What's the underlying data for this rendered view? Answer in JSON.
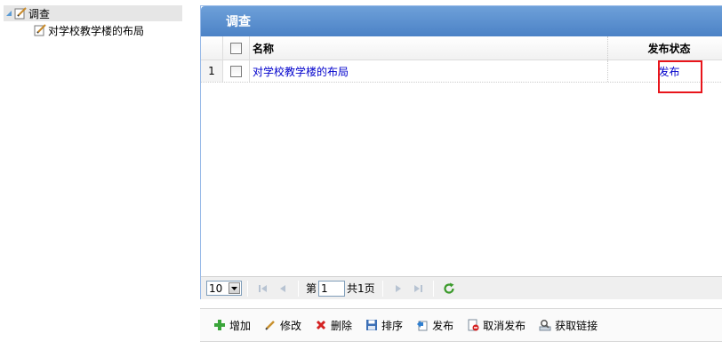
{
  "tree": {
    "root_label": "调查",
    "children": [
      {
        "label": "对学校教学楼的布局"
      }
    ]
  },
  "panel": {
    "title": "调查",
    "columns": {
      "name": "名称",
      "status": "发布状态"
    },
    "rows": [
      {
        "num": "1",
        "name": "对学校教学楼的布局",
        "status": "发布"
      }
    ]
  },
  "pager": {
    "page_size": "10",
    "page_prefix": "第",
    "current_page": "1",
    "total_text": "共1页"
  },
  "toolbar": {
    "add": "增加",
    "edit": "修改",
    "delete": "删除",
    "sort": "排序",
    "publish": "发布",
    "unpublish": "取消发布",
    "get_link": "获取链接"
  },
  "colors": {
    "header_blue": "#5a8fd0",
    "link_blue": "#0000cc",
    "highlight_red": "#e8151b"
  }
}
